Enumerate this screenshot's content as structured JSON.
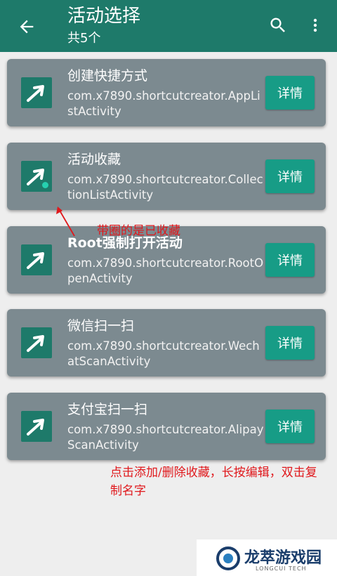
{
  "appbar": {
    "title": "活动选择",
    "subtitle": "共5个"
  },
  "items": [
    {
      "title": "创建快捷方式",
      "activity": "com.x7890.shortcutcreator.AppListActivity",
      "detail_label": "详情",
      "favorited": false
    },
    {
      "title": "活动收藏",
      "activity": "com.x7890.shortcutcreator.CollectionListActivity",
      "detail_label": "详情",
      "favorited": true
    },
    {
      "title": "Root强制打开活动",
      "activity": "com.x7890.shortcutcreator.RootOpenActivity",
      "detail_label": "详情",
      "favorited": false
    },
    {
      "title": "微信扫一扫",
      "activity": "com.x7890.shortcutcreator.WechatScanActivity",
      "detail_label": "详情",
      "favorited": false
    },
    {
      "title": "支付宝扫一扫",
      "activity": "com.x7890.shortcutcreator.AlipayScanActivity",
      "detail_label": "详情",
      "favorited": false
    }
  ],
  "annotations": {
    "favorite_note": "带圈的是已收藏",
    "usage_note": "点击添加/删除收藏，长按编辑，双击复制名字"
  },
  "watermark": {
    "name": "龙萃游戏园",
    "sub": "LONGCUI TECH"
  },
  "colors": {
    "appbar": "#1e7a6a",
    "card": "#7c8a90",
    "detail_button": "#179c86",
    "annotation": "#e0181c"
  },
  "icons": {
    "back": "arrow-left-icon",
    "search": "search-icon",
    "more": "more-vert-icon",
    "app": "shortcut-arrow-icon"
  }
}
